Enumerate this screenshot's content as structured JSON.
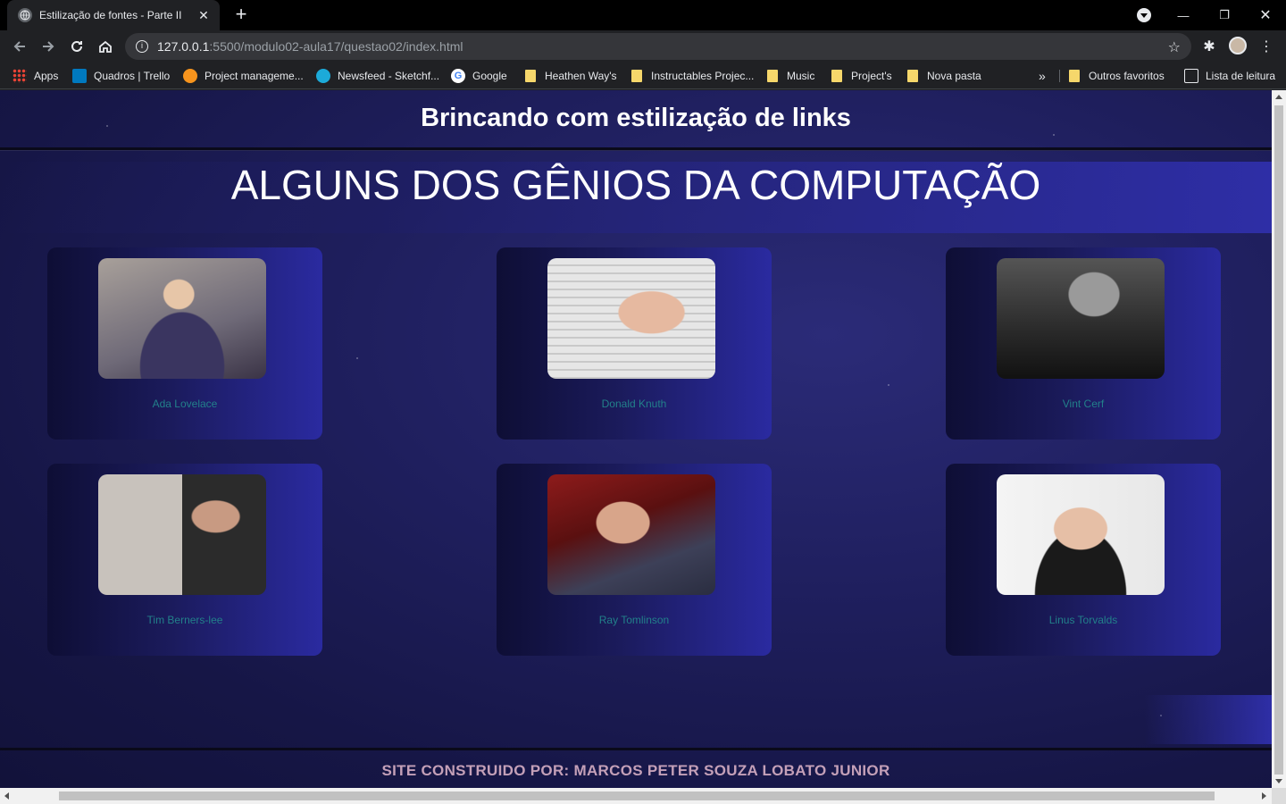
{
  "browser": {
    "tab_title": "Estilização de fontes - Parte II",
    "url_host": "127.0.0.1",
    "url_path": ":5500/modulo02-aula17/questao02/index.html",
    "bookmarks": [
      {
        "label": "Apps",
        "icon": "apps-grid-icon"
      },
      {
        "label": "Quadros | Trello",
        "icon": "trello-icon"
      },
      {
        "label": "Project manageme...",
        "icon": "hubstaff-icon"
      },
      {
        "label": "Newsfeed - Sketchf...",
        "icon": "sketchfab-icon"
      },
      {
        "label": "Google",
        "icon": "google-icon"
      },
      {
        "label": "Heathen Way's",
        "icon": "folder-icon"
      },
      {
        "label": "Instructables Projec...",
        "icon": "folder-icon"
      },
      {
        "label": "Music",
        "icon": "folder-icon"
      },
      {
        "label": "Project's",
        "icon": "folder-icon"
      },
      {
        "label": "Nova pasta",
        "icon": "folder-icon"
      }
    ],
    "overflow_label": "»",
    "other_bookmarks": "Outros favoritos",
    "reading_list": "Lista de leitura"
  },
  "page": {
    "header_title": "Brincando com estilização de links",
    "main_title": "ALGUNS DOS GÊNIOS DA COMPUTAÇÃO",
    "cards": [
      {
        "name": "Ada Lovelace"
      },
      {
        "name": "Donald Knuth"
      },
      {
        "name": "Vint Cerf"
      },
      {
        "name": "Tim Berners-lee"
      },
      {
        "name": "Ray Tomlinson"
      },
      {
        "name": "Linus Torvalds"
      }
    ],
    "footer": "SITE CONSTRUIDO POR: MARCOS PETER SOUZA LOBATO JUNIOR"
  },
  "colors": {
    "background": "#1f1f5e",
    "link": "#22808a",
    "footer_text": "#c4a0b8",
    "card_accent": "#2a2aa0"
  }
}
